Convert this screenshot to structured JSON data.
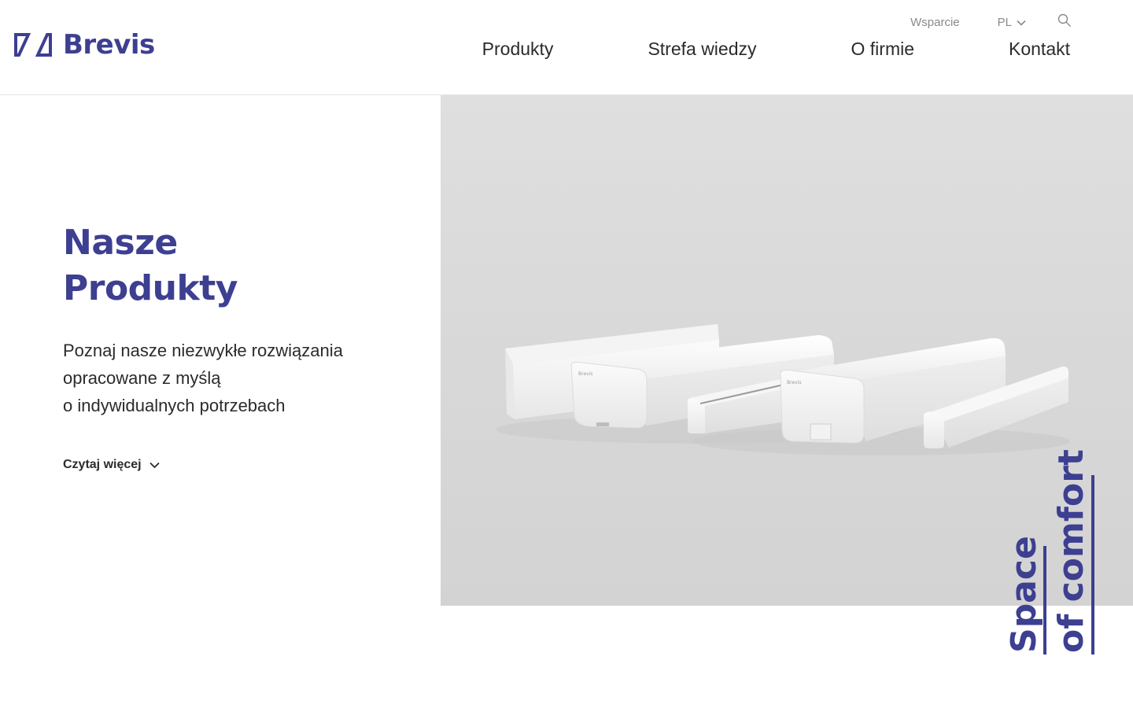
{
  "brand": {
    "name": "Brevis",
    "color": "#3d3f91"
  },
  "utility": {
    "support": "Wsparcie",
    "language": "PL",
    "search_icon": "search-icon",
    "chevron_icon": "chevron-down-icon"
  },
  "nav": {
    "items": [
      {
        "label": "Produkty"
      },
      {
        "label": "Strefa wiedzy"
      },
      {
        "label": "O firmie"
      },
      {
        "label": "Kontakt"
      }
    ]
  },
  "hero": {
    "title_lines": [
      "Nasze",
      "Produkty"
    ],
    "text_lines": [
      "Poznaj nasze niezwykłe rozwiązania",
      "opracowane z myślą",
      "o indywidualnych potrzebach"
    ],
    "read_more": "Czytaj więcej",
    "image_label": "Brevis",
    "slogan_lines": [
      "Space",
      "of comfort"
    ]
  }
}
